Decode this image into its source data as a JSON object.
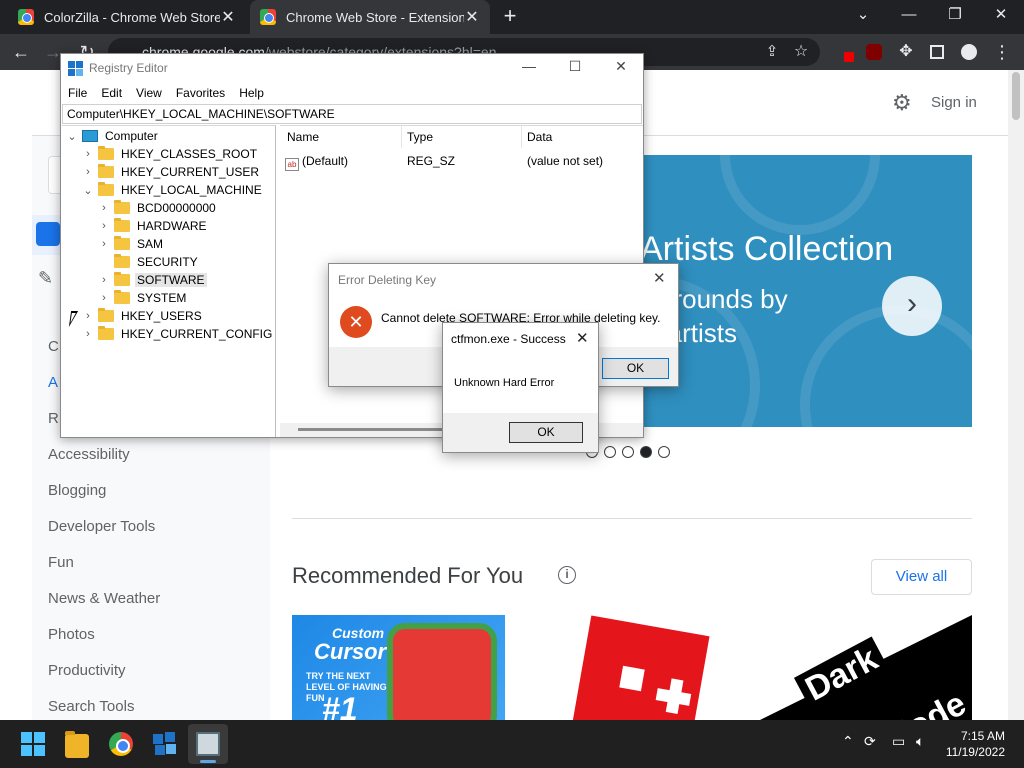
{
  "browser": {
    "tabs": [
      {
        "title": "ColorZilla - Chrome Web Store"
      },
      {
        "title": "Chrome Web Store - Extensions"
      }
    ],
    "url_host": "chrome.google.com",
    "url_path": "/webstore/category/extensions?hl=en",
    "new_tab_label": "+",
    "window_controls": {
      "minimize": "—",
      "restore": "❐",
      "close": "✕",
      "tablist": "⌄"
    }
  },
  "webstore": {
    "header": {
      "signin": "Sign in"
    },
    "sidebar_clipped": {
      "c": "C",
      "a": "A",
      "r": "R"
    },
    "categories": [
      "Accessibility",
      "Blogging",
      "Developer Tools",
      "Fun",
      "News & Weather",
      "Photos",
      "Productivity",
      "Search Tools"
    ],
    "hero": {
      "title": "Artists Collection",
      "sub1": "kgrounds by",
      "sub2": "n artists",
      "next": "›"
    },
    "carousel": {
      "count": 5,
      "active": 4
    },
    "recommended": {
      "title": "Recommended For You",
      "info": "i",
      "view_all": "View all"
    },
    "cards": [
      {
        "name": "Custom Cursor",
        "top": "Custom",
        "big": "Cursor",
        "sub": "TRY THE NEXT LEVEL OF HAVING FUN",
        "num": "#1"
      },
      {
        "name": "Roblox"
      },
      {
        "name": "Dark Mode",
        "w1": "Dark",
        "w2": "Mode"
      }
    ],
    "accent": "#1a73e8",
    "hero_color": "#2f8fbf"
  },
  "regedit": {
    "title": "Registry Editor",
    "menu": [
      "File",
      "Edit",
      "View",
      "Favorites",
      "Help"
    ],
    "address": "Computer\\HKEY_LOCAL_MACHINE\\SOFTWARE",
    "tree": {
      "root": "Computer",
      "hkcr": "HKEY_CLASSES_ROOT",
      "hkcu": "HKEY_CURRENT_USER",
      "hklm": "HKEY_LOCAL_MACHINE",
      "bcd": "BCD00000000",
      "hardware": "HARDWARE",
      "sam": "SAM",
      "security": "SECURITY",
      "software": "SOFTWARE",
      "system": "SYSTEM",
      "hku": "HKEY_USERS",
      "hkcc": "HKEY_CURRENT_CONFIG"
    },
    "columns": {
      "name": "Name",
      "type": "Type",
      "data": "Data"
    },
    "values": [
      {
        "name": "(Default)",
        "type": "REG_SZ",
        "data": "(value not set)"
      }
    ]
  },
  "error_dialog": {
    "title": "Error Deleting Key",
    "message": "Cannot delete SOFTWARE:  Error while deleting key.",
    "ok": "OK"
  },
  "ctfmon_dialog": {
    "title": "ctfmon.exe - Success",
    "message": "Unknown Hard Error",
    "ok": "OK"
  },
  "taskbar": {
    "time": "7:15 AM",
    "date": "11/19/2022"
  }
}
